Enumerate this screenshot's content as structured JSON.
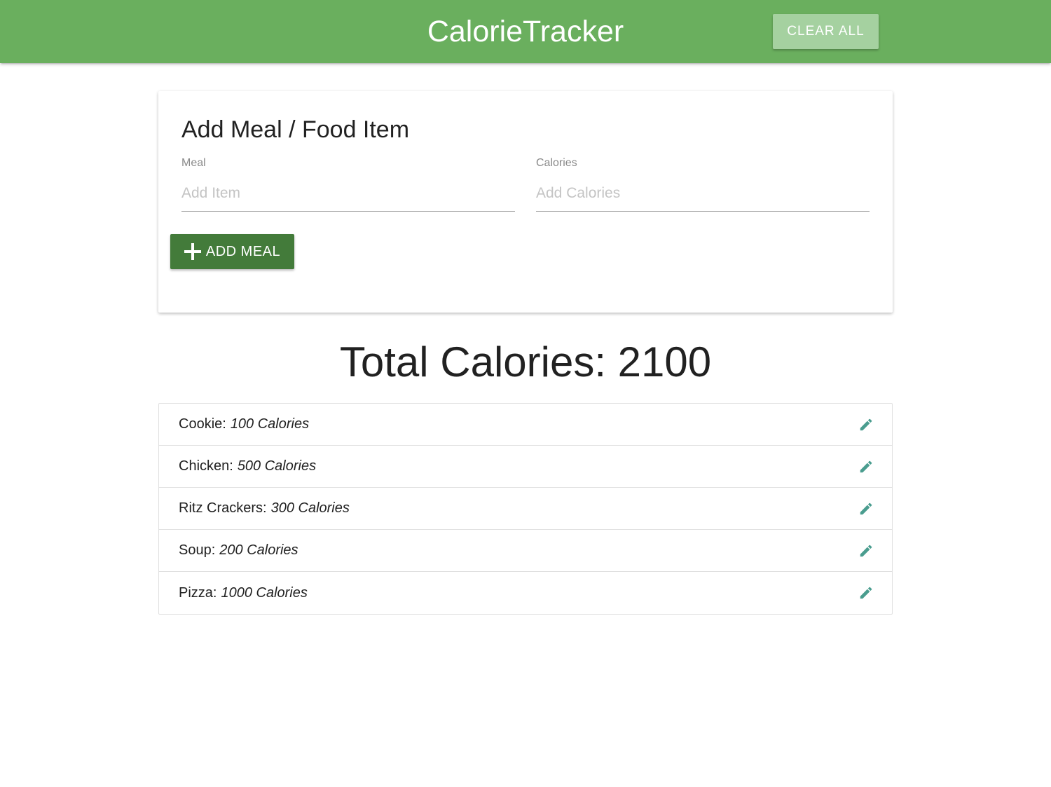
{
  "navbar": {
    "brand": "CalorieTracker",
    "clear_label": "CLEAR ALL",
    "color": "#6aaf5e"
  },
  "form": {
    "title": "Add Meal / Food Item",
    "meal_label": "Meal",
    "meal_placeholder": "Add Item",
    "meal_value": "",
    "calories_label": "Calories",
    "calories_placeholder": "Add Calories",
    "calories_value": "",
    "add_label": "ADD MEAL",
    "add_icon": "plus-icon",
    "add_color": "#437b3a"
  },
  "total": {
    "text": "Total Calories: 2100"
  },
  "items": [
    {
      "name": "Cookie:",
      "calories": "100 Calories",
      "icon": "pencil-icon"
    },
    {
      "name": "Chicken:",
      "calories": "500 Calories",
      "icon": "pencil-icon"
    },
    {
      "name": "Ritz Crackers:",
      "calories": "300 Calories",
      "icon": "pencil-icon"
    },
    {
      "name": "Soup:",
      "calories": "200 Calories",
      "icon": "pencil-icon"
    },
    {
      "name": "Pizza:",
      "calories": "1000 Calories",
      "icon": "pencil-icon"
    }
  ],
  "colors": {
    "edit_icon": "#4a9d8f"
  }
}
